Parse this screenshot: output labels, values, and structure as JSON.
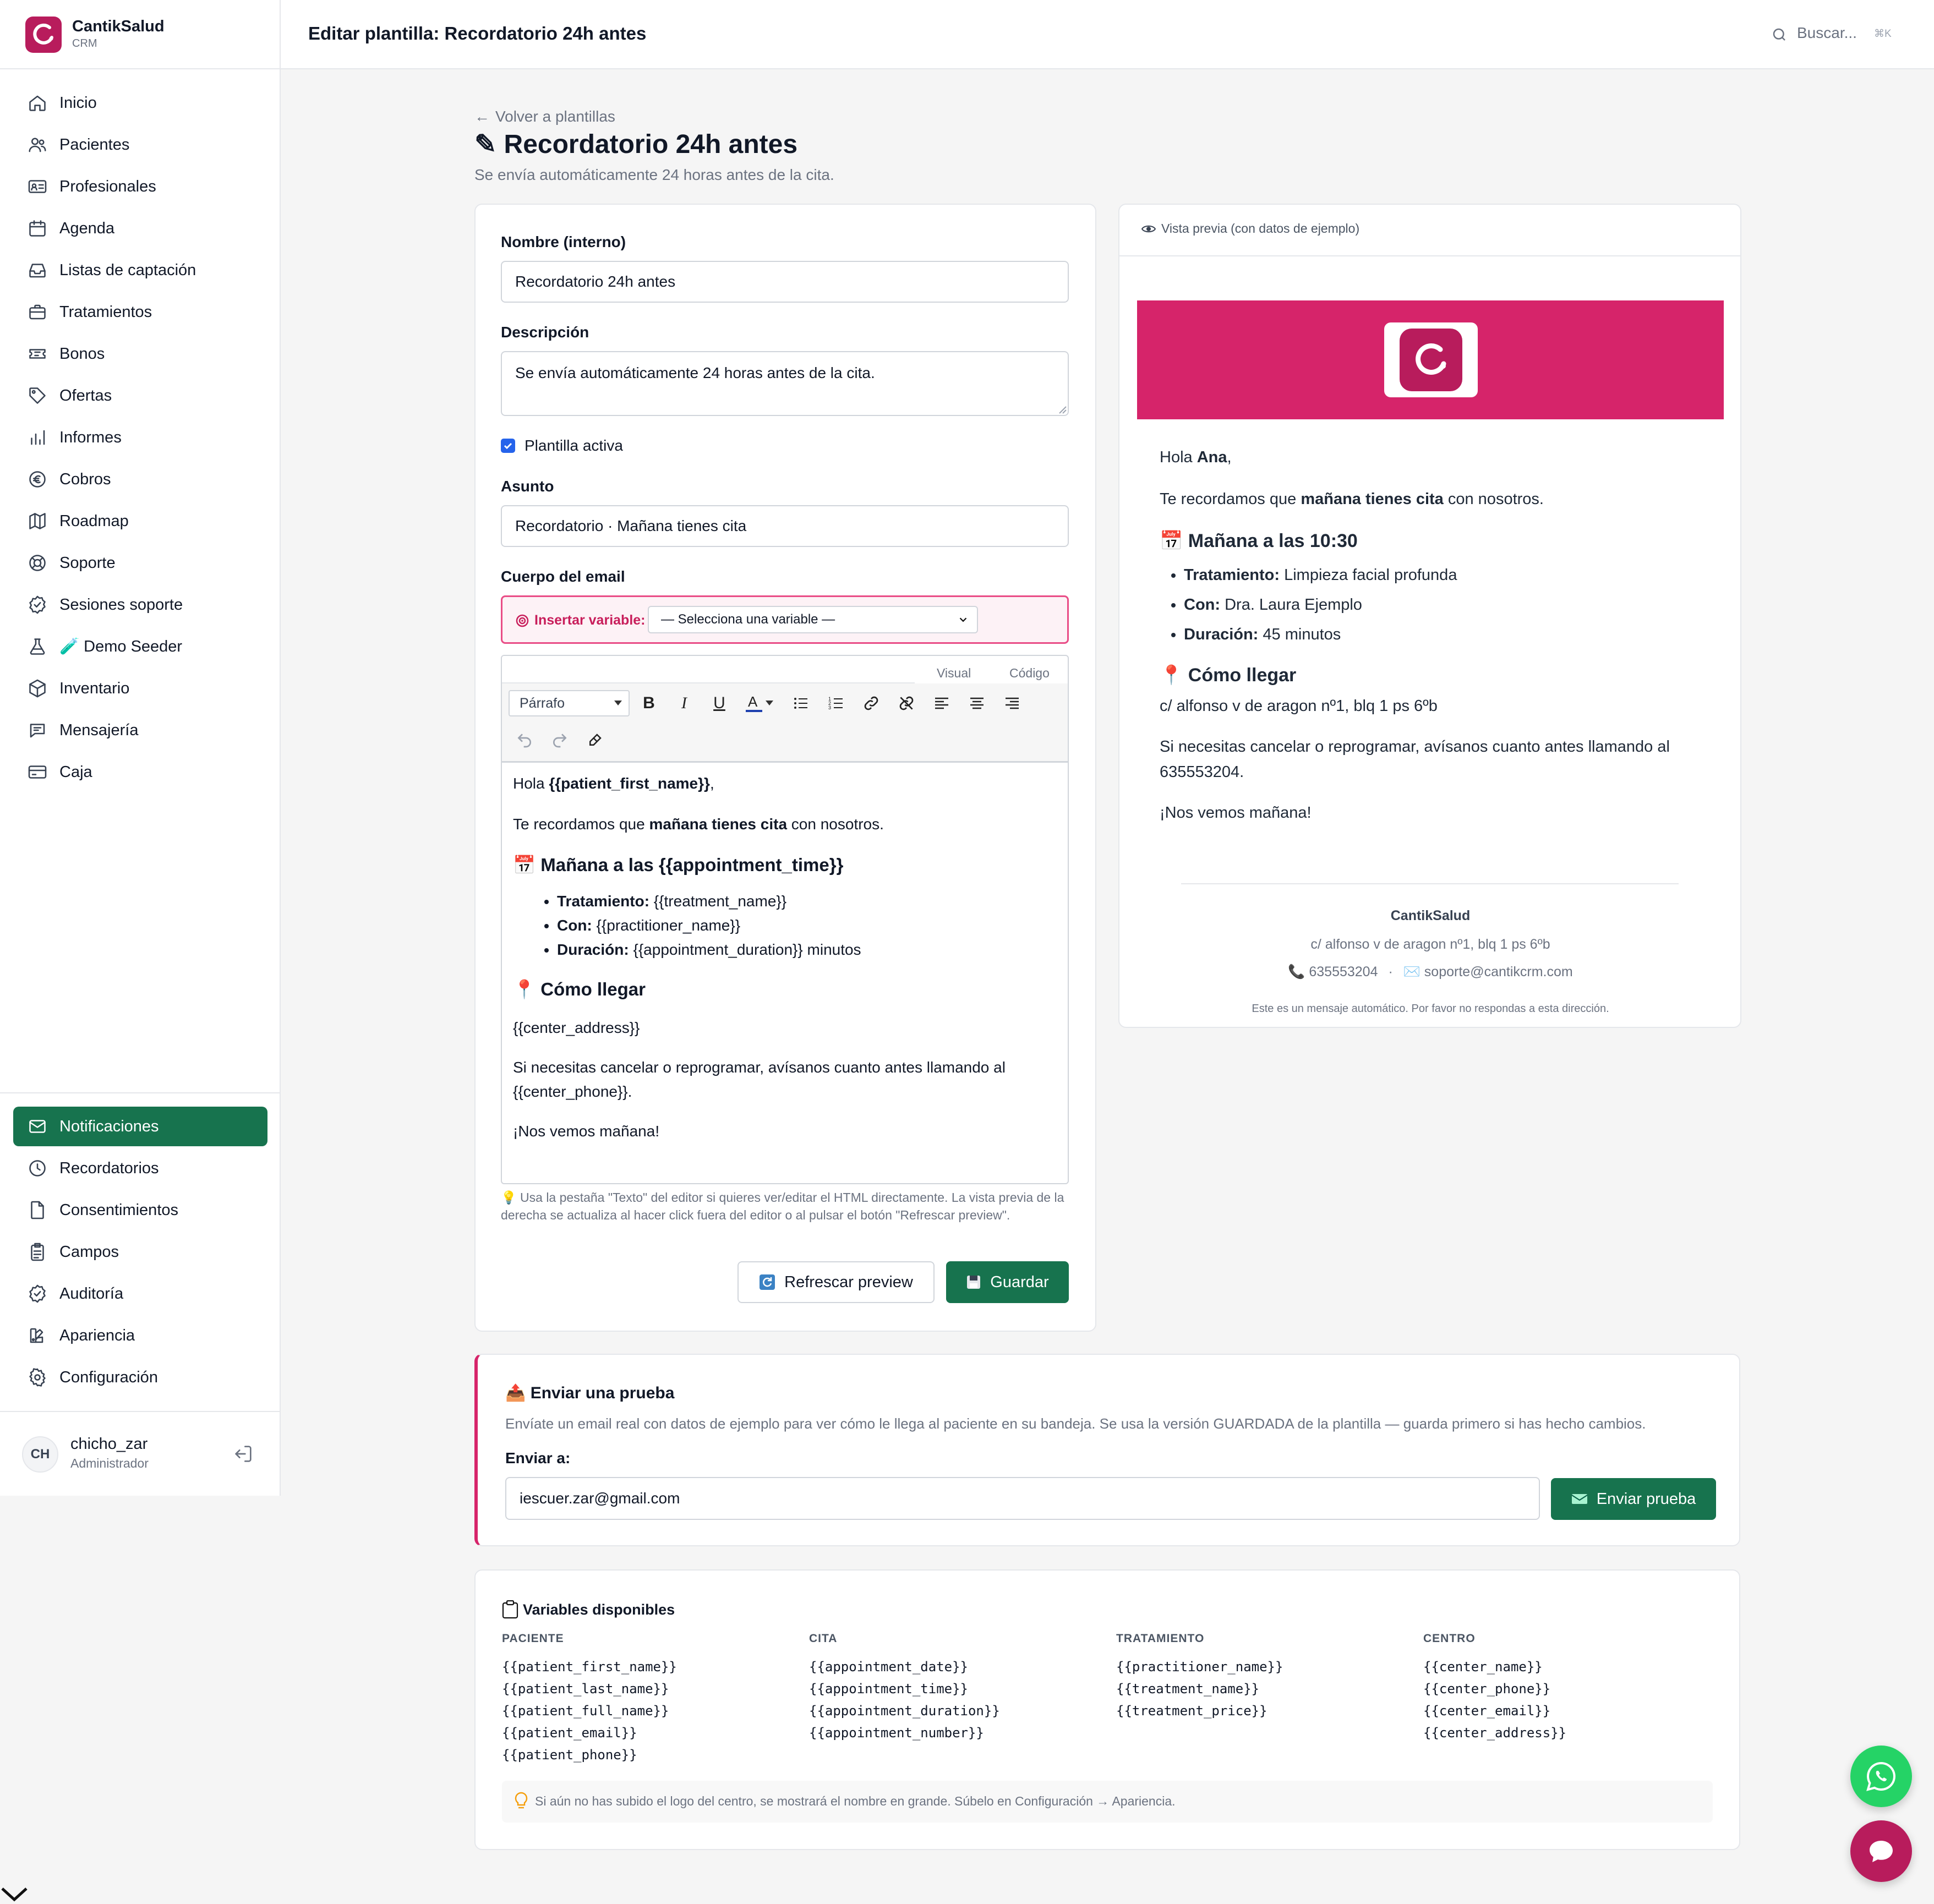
{
  "brand": {
    "name": "CantikSalud",
    "sub": "CRM",
    "color": "#b81c5c"
  },
  "nav": {
    "items": [
      {
        "label": "Inicio",
        "icon": "home-icon"
      },
      {
        "label": "Pacientes",
        "icon": "users-icon"
      },
      {
        "label": "Profesionales",
        "icon": "id-card-icon"
      },
      {
        "label": "Agenda",
        "icon": "calendar-icon"
      },
      {
        "label": "Listas de captación",
        "icon": "inbox-icon"
      },
      {
        "label": "Tratamientos",
        "icon": "briefcase-icon"
      },
      {
        "label": "Bonos",
        "icon": "ticket-icon"
      },
      {
        "label": "Ofertas",
        "icon": "tag-icon"
      },
      {
        "label": "Informes",
        "icon": "bar-chart-icon"
      },
      {
        "label": "Cobros",
        "icon": "euro-icon"
      },
      {
        "label": "Roadmap",
        "icon": "map-icon"
      },
      {
        "label": "Soporte",
        "icon": "lifebuoy-icon"
      },
      {
        "label": "Sesiones soporte",
        "icon": "check-badge-icon"
      },
      {
        "label": "🧪 Demo Seeder",
        "icon": "flask-icon"
      },
      {
        "label": "Inventario",
        "icon": "box-icon"
      },
      {
        "label": "Mensajería",
        "icon": "chat-icon"
      },
      {
        "label": "Caja",
        "icon": "credit-card-icon"
      }
    ],
    "bottom_items": [
      {
        "label": "Notificaciones",
        "icon": "mail-icon",
        "active": true
      },
      {
        "label": "Recordatorios",
        "icon": "clock-icon"
      },
      {
        "label": "Consentimientos",
        "icon": "document-icon"
      },
      {
        "label": "Campos",
        "icon": "clipboard-icon"
      },
      {
        "label": "Auditoría",
        "icon": "check-badge-icon"
      },
      {
        "label": "Apariencia",
        "icon": "palette-icon"
      },
      {
        "label": "Configuración",
        "icon": "gear-icon"
      }
    ]
  },
  "user": {
    "initials": "CH",
    "name": "chicho_zar",
    "role": "Administrador"
  },
  "header": {
    "title": "Editar plantilla: Recordatorio 24h antes",
    "search_placeholder": "Buscar...",
    "search_kbd": "⌘K"
  },
  "page": {
    "back_link": "Volver a plantillas",
    "title": "✎ Recordatorio 24h antes",
    "subtitle": "Se envía automáticamente 24 horas antes de la cita."
  },
  "form": {
    "name_label": "Nombre (interno)",
    "name_value": "Recordatorio 24h antes",
    "desc_label": "Descripción",
    "desc_value": "Se envía automáticamente 24 horas antes de la cita.",
    "active_label": "Plantilla activa",
    "active_checked": true,
    "subject_label": "Asunto",
    "subject_value": "Recordatorio · Mañana tienes cita",
    "body_label": "Cuerpo del email",
    "insert_var_label": "Insertar variable:",
    "insert_var_select": "— Selecciona una variable —",
    "tab_visual": "Visual",
    "tab_code": "Código",
    "block_format": "Párrafo",
    "hint": "💡 Usa la pestaña \"Texto\" del editor si quieres ver/editar el HTML directamente. La vista previa de la derecha se actualiza al hacer click fuera del editor o al pulsar el botón \"Refrescar preview\".",
    "refresh_button": "Refrescar preview",
    "save_button": "Guardar"
  },
  "editor": {
    "greeting_pre": "Hola ",
    "greeting_var": "{{patient_first_name}}",
    "greeting_post": ",",
    "line1_pre": "Te recordamos que ",
    "line1_bold": "mañana tienes cita",
    "line1_post": " con nosotros.",
    "h1": "📅 Mañana a las {{appointment_time}}",
    "li1_label": "Tratamiento:",
    "li1_value": " {{treatment_name}}",
    "li2_label": "Con:",
    "li2_value": " {{practitioner_name}}",
    "li3_label": "Duración:",
    "li3_value": " {{appointment_duration}} minutos",
    "h2": "📍 Cómo llegar",
    "address": "{{center_address}}",
    "cancel": "Si necesitas cancelar o reprogramar, avísanos cuanto antes llamando al {{center_phone}}.",
    "bye": "¡Nos vemos mañana!"
  },
  "preview": {
    "header": "Vista previa (con datos de ejemplo)",
    "banner_color": "#d6246a",
    "greeting_pre": "Hola ",
    "greeting_name": "Ana",
    "greeting_post": ",",
    "line1_pre": "Te recordamos que ",
    "line1_bold": "mañana tienes cita",
    "line1_post": " con nosotros.",
    "h1": "📅 Mañana a las 10:30",
    "li1_label": "Tratamiento:",
    "li1_value": " Limpieza facial profunda",
    "li2_label": "Con:",
    "li2_value": " Dra. Laura Ejemplo",
    "li3_label": "Duración:",
    "li3_value": " 45 minutos",
    "h2": "📍 Cómo llegar",
    "address": "c/ alfonso v de aragon nº1, blq 1 ps 6ºb",
    "cancel": "Si necesitas cancelar o reprogramar, avísanos cuanto antes llamando al 635553204.",
    "bye": "¡Nos vemos mañana!",
    "footer_name": "CantikSalud",
    "footer_address": "c/ alfonso v de aragon nº1, blq 1 ps 6ºb",
    "footer_phone": "📞 635553204",
    "footer_sep": "·",
    "footer_email": "✉️ soporte@cantikcrm.com",
    "footer_note": "Este es un mensaje automático. Por favor no respondas a esta dirección."
  },
  "test": {
    "title": "📤 Enviar una prueba",
    "desc": "Envíate un email real con datos de ejemplo para ver cómo le llega al paciente en su bandeja. Se usa la versión GUARDADA de la plantilla — guarda primero si has hecho cambios.",
    "to_label": "Enviar a:",
    "to_value": "iescuer.zar@gmail.com",
    "send_button": "Enviar prueba"
  },
  "variables": {
    "title": "Variables disponibles",
    "columns": [
      {
        "title": "PACIENTE",
        "items": [
          "{{patient_first_name}}",
          "{{patient_last_name}}",
          "{{patient_full_name}}",
          "{{patient_email}}",
          "{{patient_phone}}"
        ]
      },
      {
        "title": "CITA",
        "items": [
          "{{appointment_date}}",
          "{{appointment_time}}",
          "{{appointment_duration}}",
          "{{appointment_number}}"
        ]
      },
      {
        "title": "TRATAMIENTO",
        "items": [
          "{{practitioner_name}}",
          "{{treatment_name}}",
          "{{treatment_price}}"
        ]
      },
      {
        "title": "CENTRO",
        "items": [
          "{{center_name}}",
          "{{center_phone}}",
          "{{center_email}}",
          "{{center_address}}"
        ]
      }
    ],
    "tip": "Si aún no has subido el logo del centro, se mostrará el nombre en grande. Súbelo en Configuración → Apariencia."
  },
  "colors": {
    "accent": "#17734e",
    "brand": "#d6246a",
    "whatsapp": "#25d366",
    "chat": "#b81c5c"
  }
}
